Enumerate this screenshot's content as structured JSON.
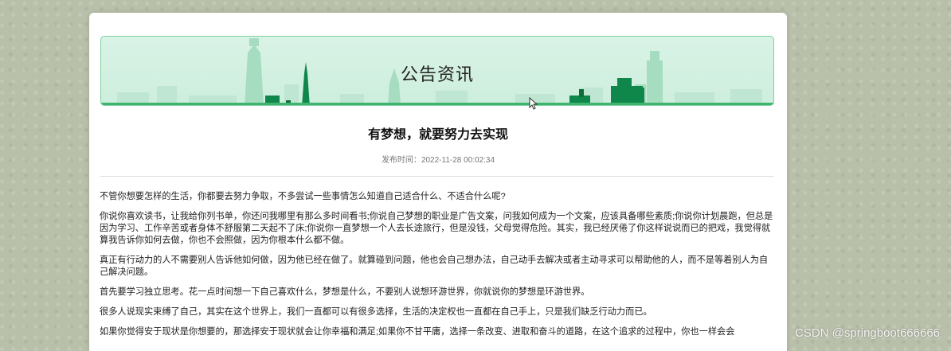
{
  "banner": {
    "title": "公告资讯"
  },
  "article": {
    "title": "有梦想，就要努力去实现",
    "publish_label": "发布时间：",
    "publish_time": "2022-11-28 00:02:34",
    "paragraphs": [
      "不管你想要怎样的生活，你都要去努力争取，不多尝试一些事情怎么知道自己适合什么、不适合什么呢?",
      "你说你喜欢读书，让我给你列书单，你还问我哪里有那么多时间看书;你说自己梦想的职业是广告文案，问我如何成为一个文案，应该具备哪些素质;你说你计划晨跑，但总是因为学习、工作辛苦或者身体不舒服第二天起不了床;你说你一直梦想一个人去长途旅行，但是没钱，父母觉得危险。其实，我已经厌倦了你这样说说而已的把戏，我觉得就算我告诉你如何去做，你也不会照做，因为你根本什么都不做。",
      "真正有行动力的人不需要别人告诉他如何做，因为他已经在做了。就算碰到问题，他也会自己想办法，自己动手去解决或者主动寻求可以帮助他的人，而不是等着别人为自己解决问题。",
      "首先要学习独立思考。花一点时间想一下自己喜欢什么，梦想是什么，不要别人说想环游世界，你就说你的梦想是环游世界。",
      "很多人说现实束缚了自己，其实在这个世界上，我们一直都可以有很多选择，生活的决定权也一直都在自己手上，只是我们缺乏行动力而已。",
      "如果你觉得安于现状是你想要的，那选择安于现状就会让你幸福和满足;如果你不甘平庸，选择一条改变、进取和奋斗的道路，在这个追求的过程中，你也一样会会"
    ]
  },
  "watermark": "CSDN @springboot666666",
  "colors": {
    "banner_bg": "#d9f3e6",
    "banner_accent": "#3fb46f",
    "page_bg": "#b9c0aa"
  }
}
